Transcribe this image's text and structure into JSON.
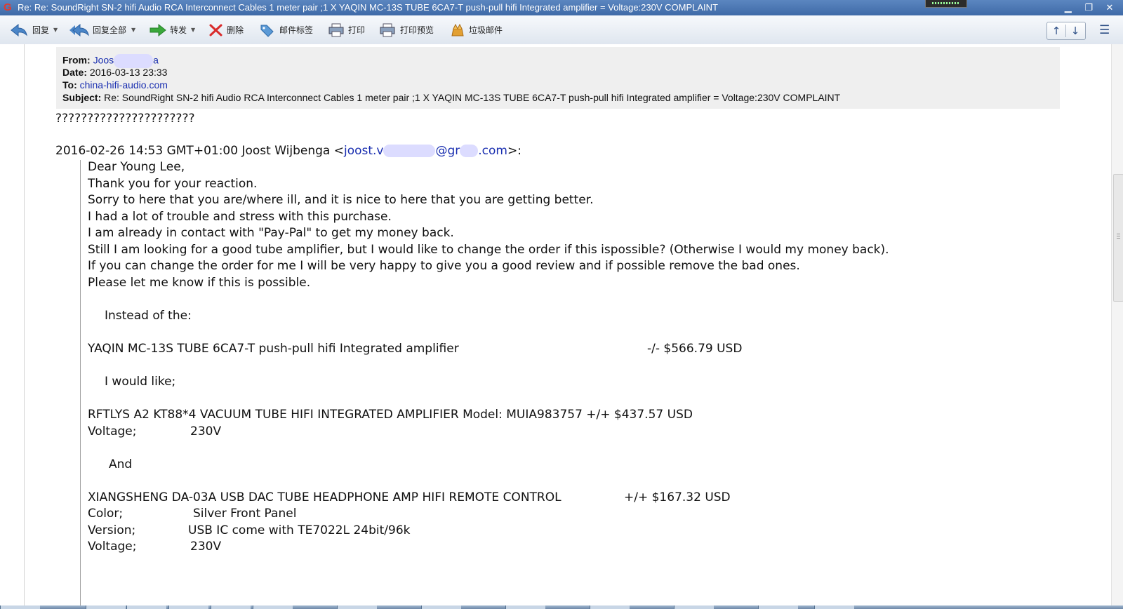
{
  "window": {
    "title": "Re: Re: SoundRight SN-2 hifi Audio RCA Interconnect Cables 1 meter pair ;1 X YAQIN MC-13S TUBE 6CA7-T push-pull hifi Integrated amplifier = Voltage:230V COMPLAINT",
    "app_icon": "G",
    "buttons": {
      "minimize": "▁",
      "restore": "❐",
      "close": "✕"
    }
  },
  "toolbar": {
    "items": [
      {
        "label": "回复",
        "icon": "reply-icon",
        "dropdown": true
      },
      {
        "label": "回复全部",
        "icon": "reply-all-icon",
        "dropdown": true
      },
      {
        "label": "转发",
        "icon": "forward-icon",
        "dropdown": true
      },
      {
        "label": "删除",
        "icon": "delete-icon",
        "dropdown": false
      },
      {
        "label": "邮件标签",
        "icon": "tag-icon",
        "dropdown": false
      },
      {
        "label": "打印",
        "icon": "print-icon",
        "dropdown": false
      },
      {
        "label": "打印预览",
        "icon": "print-preview-icon",
        "dropdown": false
      },
      {
        "label": "垃圾邮件",
        "icon": "spam-icon",
        "dropdown": false
      }
    ],
    "nav": {
      "prev": "↑",
      "next": "↓"
    },
    "menu_icon": "☰"
  },
  "header": {
    "from_label": "From:",
    "from_value_a": "Joos",
    "from_value_b": "a",
    "date_label": "Date:",
    "date_value": "2016-03-13 23:33",
    "to_label": "To:",
    "to_value": "china-hifi-audio.com",
    "subject_label": "Subject:",
    "subject_value": "Re: SoundRight SN-2 hifi Audio RCA Interconnect Cables 1 meter pair ;1 X YAQIN MC-13S TUBE 6CA7-T push-pull hifi Integrated amplifier = Voltage:230V COMPLAINT"
  },
  "body": {
    "question_marks": "??????????????????????",
    "quote_header": {
      "prefix": "2016-02-26 14:53 GMT+01:00 Joost Wijbenga <",
      "email_a": "joost.v",
      "email_b": "@gr",
      "email_c": ".com",
      "suffix": ">:"
    },
    "quote_lines": [
      "Dear Young Lee,",
      "Thank you for your reaction.",
      "Sorry to here that you are/where ill, and it is nice to here that you are getting better.",
      "I had a lot of trouble and stress with this purchase.",
      "I am already in contact with \"Pay-Pal\" to get my money back.",
      "Still I am looking for a good tube amplifier, but I would like to change the order if this ispossible? (Otherwise I would my money back).",
      "If you can change the order for me I will be very happy to give you a good review and if possible remove the bad ones.",
      "Please let me know if this is possible."
    ],
    "instead_of": "Instead of the:",
    "item1_name": "YAQIN MC-13S TUBE 6CA7-T push-pull hifi Integrated amplifier",
    "item1_price": "-/-  $566.79 USD",
    "would_like": "I would like;",
    "item2_name": "RFTLYS A2 KT88*4 VACUUM TUBE HIFI INTEGRATED AMPLIFIER   Model: MUIA983757   +/+ $437.57 USD",
    "item2_voltage_label": "Voltage;",
    "item2_voltage_value": "230V",
    "and": "And",
    "item3_name": "XIANGSHENG DA-03A USB DAC TUBE HEADPHONE AMP HIFI REMOTE CONTROL",
    "item3_price": "+/+  $167.32 USD",
    "item3_color_label": "Color;",
    "item3_color_value": "Silver Front Panel",
    "item3_version_label": "Version;",
    "item3_version_value": "USB IC come with TE7022L 24bit/96k",
    "item3_voltage_label": "Voltage;",
    "item3_voltage_value": "230V"
  }
}
